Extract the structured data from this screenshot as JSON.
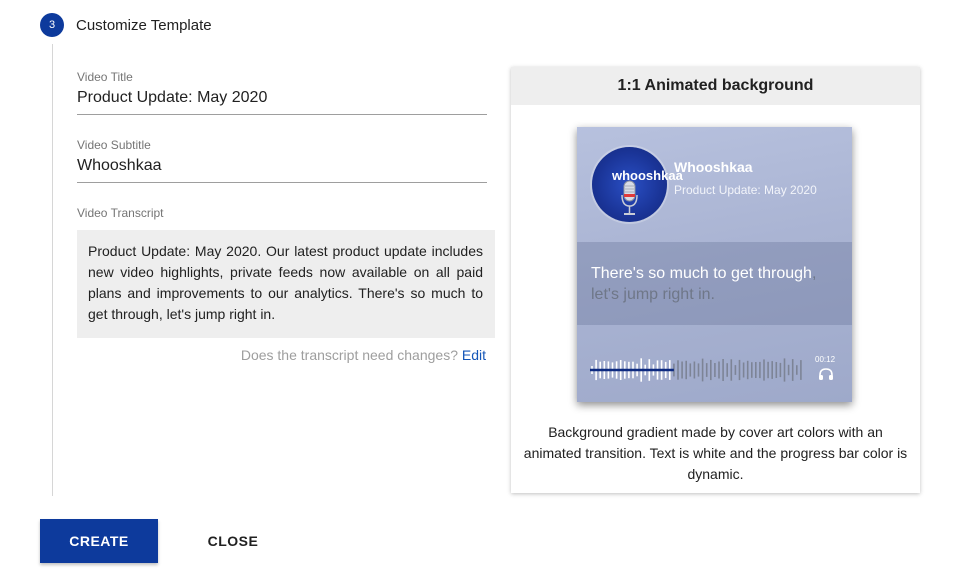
{
  "step": {
    "number": "3",
    "title": "Customize Template"
  },
  "form": {
    "video_title": {
      "label": "Video Title",
      "value": "Product Update: May 2020"
    },
    "video_subtitle": {
      "label": "Video Subtitle",
      "value": "Whooshkaa"
    },
    "transcript": {
      "label": "Video Transcript",
      "value": "Product Update: May 2020. Our latest product update includes new video highlights, private feeds now available on all paid plans and improvements to our analytics. There's so much to get through, let's jump right in.",
      "help_text": "Does the transcript need changes?",
      "edit_link": "Edit"
    }
  },
  "preview": {
    "header": "1:1 Animated background",
    "tile": {
      "cover_art_text": "whooshkaa",
      "title": "Whooshkaa",
      "subtitle": "Product Update: May 2020",
      "transcript_spoken": "There's so much to get through",
      "transcript_upcoming": ", let's jump right in.",
      "time": "00:12",
      "progress": 0.38,
      "progress_color": "#0d2a80",
      "inactive_wave_color": "#7d8496"
    },
    "description": "Background gradient made by cover art colors with an animated transition. Text is white and the progress bar color is dynamic."
  },
  "actions": {
    "create_label": "CREATE",
    "close_label": "CLOSE"
  },
  "colors": {
    "primary": "#0d3a9c",
    "link": "#1456b8"
  }
}
